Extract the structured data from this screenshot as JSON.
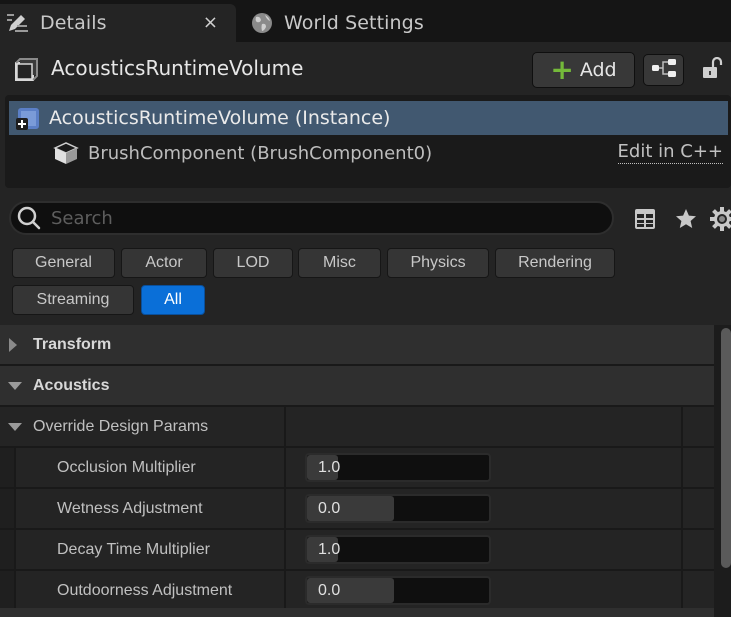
{
  "tabs": [
    {
      "label": "Details",
      "icon": "pencil-details-icon",
      "active": true,
      "closable": true
    },
    {
      "label": "World Settings",
      "icon": "globe-icon",
      "active": false
    }
  ],
  "tab_close_glyph": "×",
  "header": {
    "actor_name": "AcousticsRuntimeVolume",
    "add_label": "Add",
    "add_glyph": "+"
  },
  "tree": {
    "instance_label": "AcousticsRuntimeVolume (Instance)",
    "component_label": "BrushComponent (BrushComponent0)",
    "edit_cpp_label": "Edit in C++"
  },
  "search": {
    "placeholder": "Search",
    "value": ""
  },
  "filters": [
    {
      "label": "General",
      "active": false
    },
    {
      "label": "Actor",
      "active": false
    },
    {
      "label": "LOD",
      "active": false
    },
    {
      "label": "Misc",
      "active": false
    },
    {
      "label": "Physics",
      "active": false
    },
    {
      "label": "Rendering",
      "active": false
    },
    {
      "label": "Streaming",
      "active": false
    },
    {
      "label": "All",
      "active": true
    }
  ],
  "categories": {
    "transform": {
      "label": "Transform",
      "expanded": false
    },
    "acoustics": {
      "label": "Acoustics",
      "expanded": true
    },
    "override": {
      "label": "Override Design Params",
      "expanded": true
    }
  },
  "properties": [
    {
      "name": "Occlusion Multiplier",
      "value": "1.0",
      "slider_fraction": 0.17
    },
    {
      "name": "Wetness Adjustment",
      "value": "0.0",
      "slider_fraction": 0.48
    },
    {
      "name": "Decay Time Multiplier",
      "value": "1.0",
      "slider_fraction": 0.17
    },
    {
      "name": "Outdoorness Adjustment",
      "value": "0.0",
      "slider_fraction": 0.48
    }
  ],
  "colors": {
    "accent_active_filter": "#0a6fd8",
    "selection_row": "#415870",
    "add_plus": "#74b93a"
  }
}
